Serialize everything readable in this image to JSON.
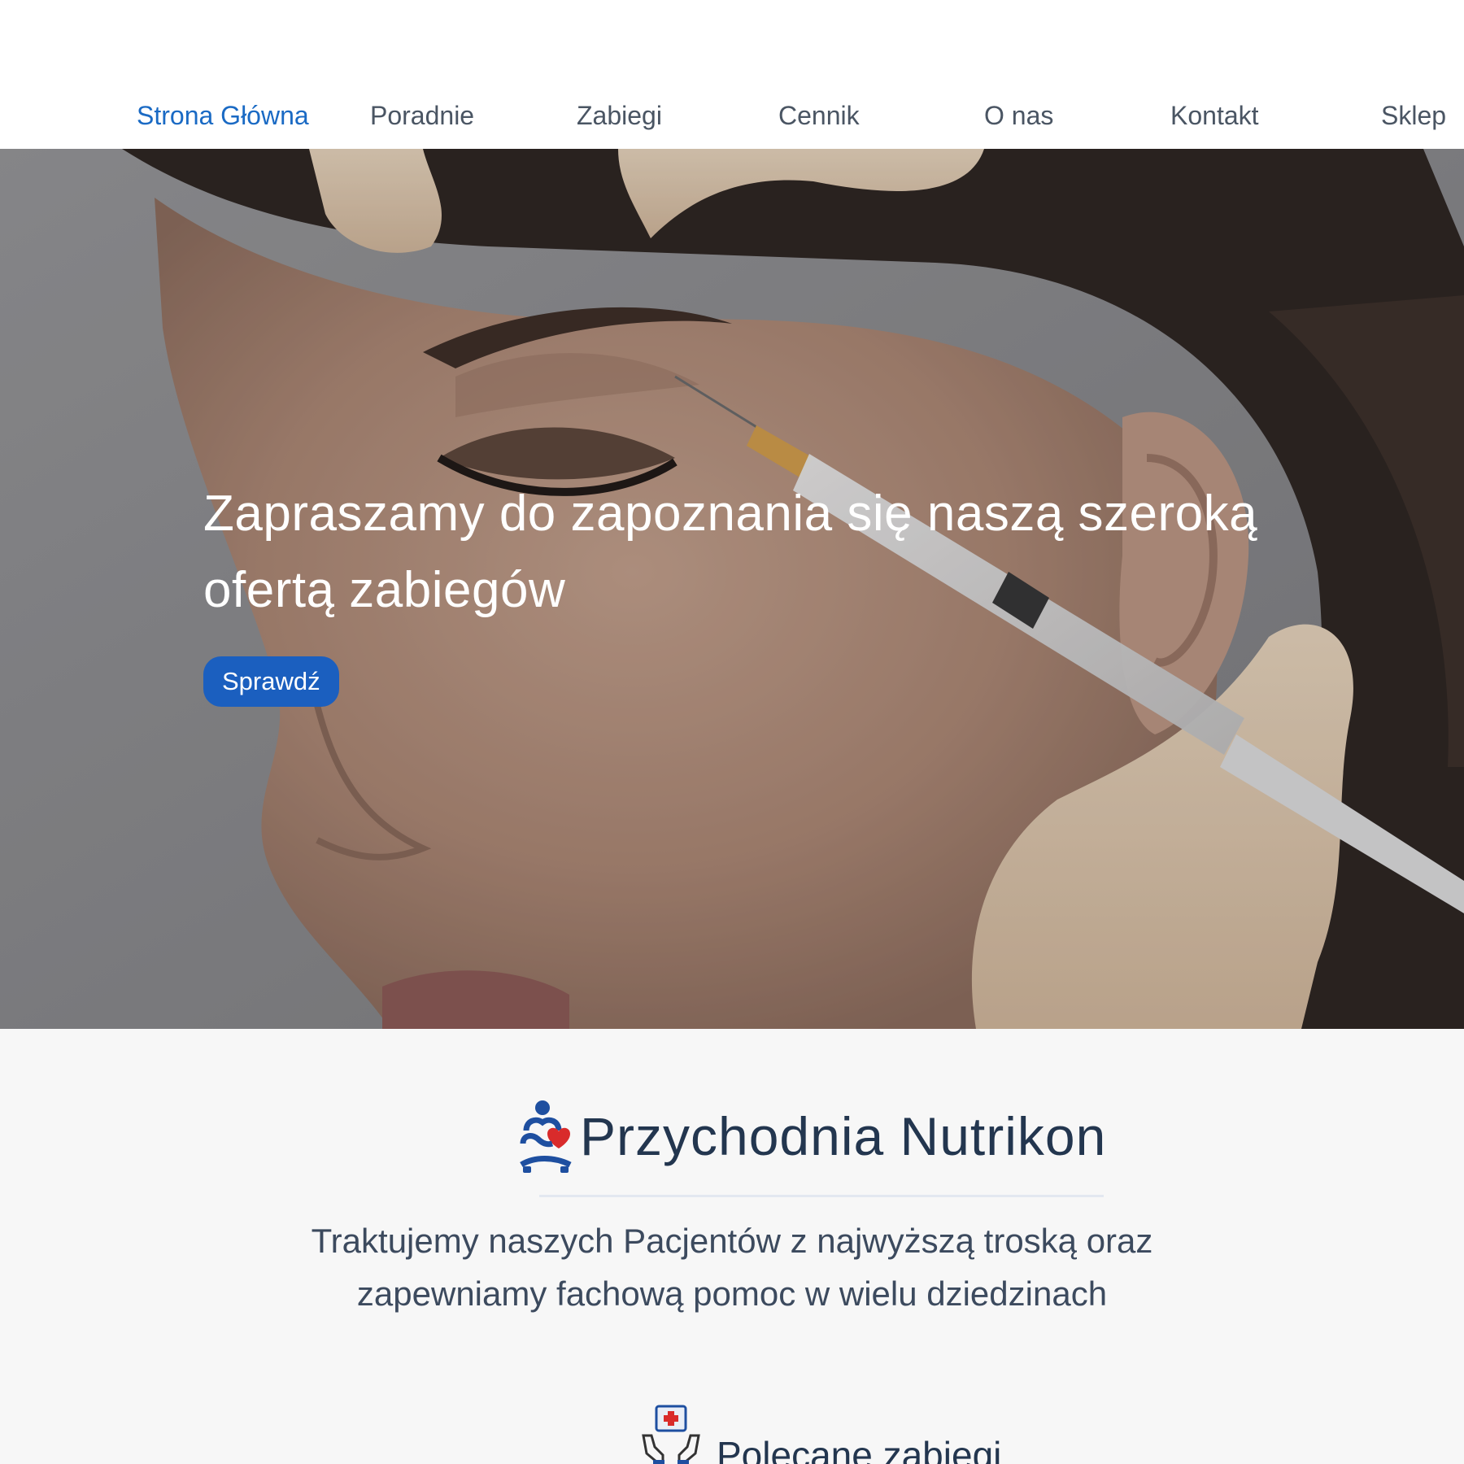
{
  "nav": {
    "items": [
      {
        "label": "Strona Główna",
        "active": true
      },
      {
        "label": "Poradnie",
        "active": false
      },
      {
        "label": "Zabiegi",
        "active": false
      },
      {
        "label": "Cennik",
        "active": false
      },
      {
        "label": "O nas",
        "active": false
      },
      {
        "label": "Kontakt",
        "active": false
      },
      {
        "label": "Sklep",
        "active": false
      }
    ]
  },
  "hero": {
    "title": "Zapraszamy do zapoznania się naszą szeroką ofertą zabiegów",
    "button_label": "Sprawdź"
  },
  "intro": {
    "clinic_name": "Przychodnia Nutrikon",
    "tagline": "Traktujemy naszych Pacjentów z najwyższą troską oraz zapewniamy fachową pomoc w wielu dziedzinach",
    "featured_title": "Polecane zabiegi"
  },
  "colors": {
    "nav_active": "#1a6ac4",
    "nav_text": "#4a5563",
    "button_bg": "#1b5fbf",
    "heading": "#23364f",
    "logo_blue": "#1e4fa0",
    "logo_red": "#d92b2b"
  },
  "icons": {
    "logo": "meditating-figure-heart-logo",
    "featured": "hands-medical-kit-icon"
  }
}
